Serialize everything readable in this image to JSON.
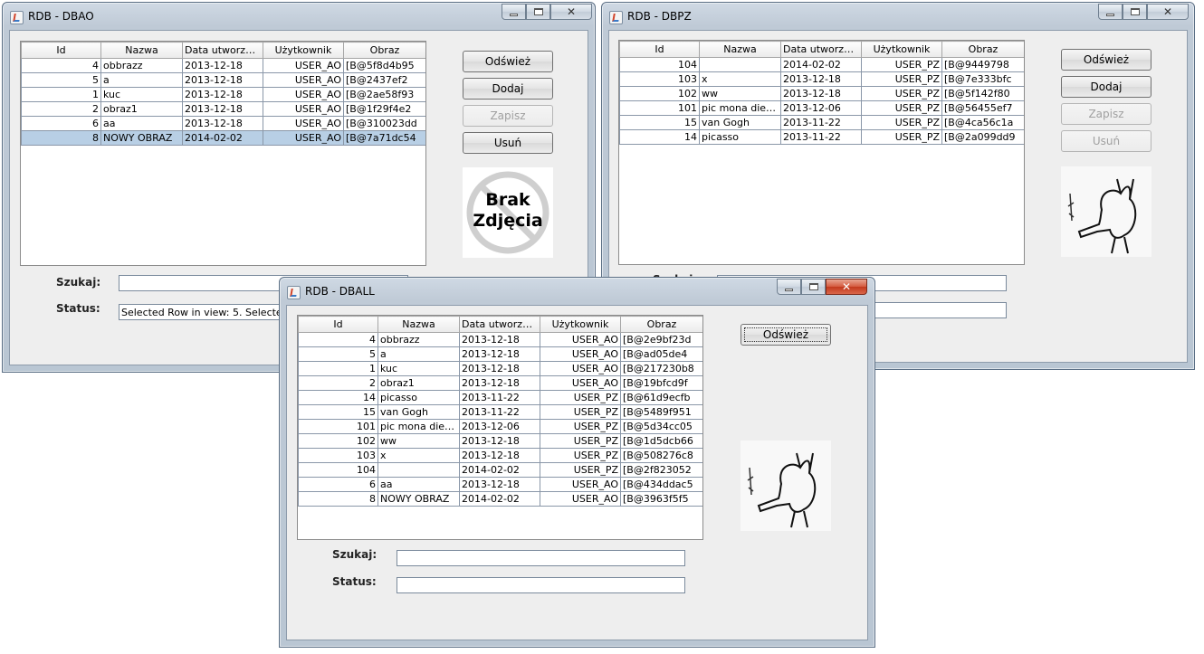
{
  "columns": [
    "Id",
    "Nazwa",
    "Data utworzen...",
    "Użytkownik",
    "Obraz"
  ],
  "buttons": {
    "refresh": "Odśwież",
    "add": "Dodaj",
    "save": "Zapisz",
    "delete": "Usuń"
  },
  "labels": {
    "search": "Szukaj:",
    "status": "Status:"
  },
  "windows": {
    "dbao": {
      "title": "RDB - DBAO",
      "rows": [
        [
          "4",
          "obbrazz",
          "2013-12-18",
          "USER_AO",
          "[B@5f8d4b95"
        ],
        [
          "5",
          "a",
          "2013-12-18",
          "USER_AO",
          "[B@2437ef2"
        ],
        [
          "1",
          "kuc",
          "2013-12-18",
          "USER_AO",
          "[B@2ae58f93"
        ],
        [
          "2",
          "obraz1",
          "2013-12-18",
          "USER_AO",
          "[B@1f29f4e2"
        ],
        [
          "6",
          "aa",
          "2013-12-18",
          "USER_AO",
          "[B@310023dd"
        ],
        [
          "8",
          "NOWY OBRAZ",
          "2014-02-02",
          "USER_AO",
          "[B@7a71dc54"
        ]
      ],
      "selected_row": 5,
      "image_text": [
        "Brak",
        "Zdjęcia"
      ],
      "search_value": "",
      "status_value": "Selected Row in view: 5. Selecte"
    },
    "dbpz": {
      "title": "RDB - DBPZ",
      "rows": [
        [
          "104",
          "",
          "2014-02-02",
          "USER_PZ",
          "[B@9449798"
        ],
        [
          "103",
          "x",
          "2013-12-18",
          "USER_PZ",
          "[B@7e333bfc"
        ],
        [
          "102",
          "ww",
          "2013-12-18",
          "USER_PZ",
          "[B@5f142f80"
        ],
        [
          "101",
          "pic mona dies...",
          "2013-12-06",
          "USER_PZ",
          "[B@56455ef7"
        ],
        [
          "15",
          "van Gogh",
          "2013-11-22",
          "USER_PZ",
          "[B@4ca56c1a"
        ],
        [
          "14",
          "picasso",
          "2013-11-22",
          "USER_PZ",
          "[B@2a099dd9"
        ]
      ],
      "search_label_partial": "Szukaj:"
    },
    "dball": {
      "title": "RDB - DBALL",
      "rows": [
        [
          "4",
          "obbrazz",
          "2013-12-18",
          "USER_AO",
          "[B@2e9bf23d"
        ],
        [
          "5",
          "a",
          "2013-12-18",
          "USER_AO",
          "[B@ad05de4"
        ],
        [
          "1",
          "kuc",
          "2013-12-18",
          "USER_AO",
          "[B@217230b8"
        ],
        [
          "2",
          "obraz1",
          "2013-12-18",
          "USER_AO",
          "[B@19bfcd9f"
        ],
        [
          "14",
          "picasso",
          "2013-11-22",
          "USER_PZ",
          "[B@61d9ecfb"
        ],
        [
          "15",
          "van Gogh",
          "2013-11-22",
          "USER_PZ",
          "[B@5489f951"
        ],
        [
          "101",
          "pic mona dies...",
          "2013-12-06",
          "USER_PZ",
          "[B@5d34cc05"
        ],
        [
          "102",
          "ww",
          "2013-12-18",
          "USER_PZ",
          "[B@1d5dcb66"
        ],
        [
          "103",
          "x",
          "2013-12-18",
          "USER_PZ",
          "[B@508276c8"
        ],
        [
          "104",
          "",
          "2014-02-02",
          "USER_PZ",
          "[B@2f823052"
        ],
        [
          "6",
          "aa",
          "2013-12-18",
          "USER_AO",
          "[B@434ddac5"
        ],
        [
          "8",
          "NOWY OBRAZ",
          "2014-02-02",
          "USER_AO",
          "[B@3963f5f5"
        ]
      ],
      "search_value": "",
      "status_value": ""
    }
  },
  "icons": {
    "window": "java-app-icon",
    "minimize": "minimize-icon",
    "maximize": "maximize-icon",
    "close": "close-icon"
  },
  "colors": {
    "selection": "#b8cfe5",
    "close_active": "#c2391d",
    "client_bg": "#eeeeee"
  }
}
